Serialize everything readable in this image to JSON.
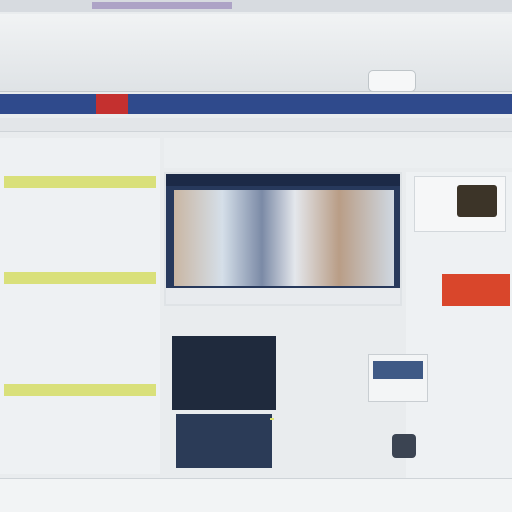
{
  "header": {
    "title": "",
    "subtitle": "",
    "button_label": ""
  },
  "nav": {
    "items": [
      {
        "label": ""
      },
      {
        "label": ""
      },
      {
        "label": ""
      },
      {
        "label": ""
      },
      {
        "label": ""
      },
      {
        "label": ""
      },
      {
        "label": ""
      },
      {
        "label": ""
      }
    ]
  },
  "subbar": {
    "text": ""
  },
  "sidebar": {
    "title": "",
    "items": [
      {
        "label": ""
      },
      {
        "label": ""
      },
      {
        "label": ""
      },
      {
        "label": ""
      },
      {
        "label": ""
      },
      {
        "label": ""
      },
      {
        "label": ""
      },
      {
        "label": ""
      },
      {
        "label": ""
      },
      {
        "label": ""
      },
      {
        "label": ""
      },
      {
        "label": ""
      },
      {
        "label": ""
      },
      {
        "label": ""
      },
      {
        "label": ""
      },
      {
        "label": ""
      }
    ]
  },
  "main": {
    "header_links": [
      "",
      "",
      ""
    ],
    "feature_caption": ""
  },
  "right_col": {
    "link1": "",
    "link2": ""
  },
  "content": {
    "line1": "",
    "line2": ""
  },
  "footer": {
    "left": "",
    "right": "",
    "right2": ""
  },
  "colors": {
    "nav_bg": "#2f4a8c",
    "nav_red": "#c4302f",
    "highlight": "#d9e07a",
    "ad_orange": "#d9462b"
  }
}
